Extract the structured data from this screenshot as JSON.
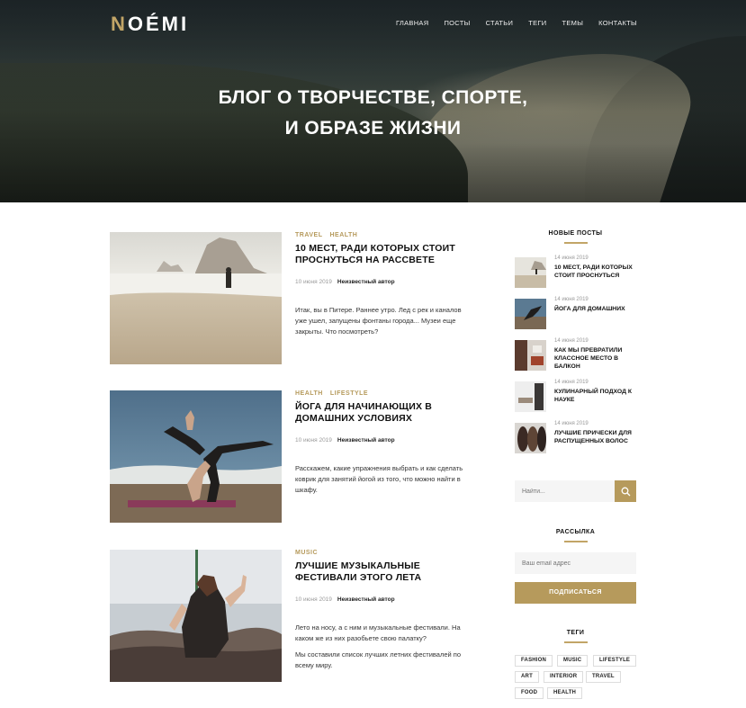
{
  "brand": {
    "logo_first": "N",
    "logo_rest": "OÉMI",
    "accent": "#c2a567"
  },
  "nav": [
    "ГЛАВНАЯ",
    "ПОСТЫ",
    "СТАТЬИ",
    "ТЕГИ",
    "ТЕМЫ",
    "КОНТАКТЫ"
  ],
  "hero": {
    "line1": "БЛОГ О ТВОРЧЕСТВЕ, СПОРТЕ,",
    "line2": "И ОБРАЗЕ ЖИЗНИ"
  },
  "posts": [
    {
      "cats": [
        "TRAVEL",
        "HEALTH"
      ],
      "title": "10 МЕСТ, РАДИ КОТОРЫХ СТОИТ ПРОСНУТЬСЯ НА РАССВЕТЕ",
      "date": "10 июня 2019",
      "author": "Неизвестный автор",
      "excerpt": "Итак, вы в Питере. Раннее утро. Лед с рек и каналов уже ушел, запущены фонтаны города... Музеи еще закрыты. Что посмотреть?"
    },
    {
      "cats": [
        "HEALTH",
        "LIFESTYLE"
      ],
      "title": "ЙОГА ДЛЯ НАЧИНАЮЩИХ В ДОМАШНИХ УСЛОВИЯХ",
      "date": "10 июня 2019",
      "author": "Неизвестный автор",
      "excerpt": "Расскажем, какие упражнения выбрать и как сделать коврик для занятий йогой из того, что можно найти в шкафу."
    },
    {
      "cats": [
        "MUSIC"
      ],
      "title": "ЛУЧШИЕ МУЗЫКАЛЬНЫЕ ФЕСТИВАЛИ ЭТОГО ЛЕТА",
      "date": "10 июня 2019",
      "author": "Неизвестный автор",
      "excerpt": "Лето на носу, а с ним и музыкальные фестивали. На каком же из них разобьете свою палатку?",
      "excerpt2": "Мы составили список лучших летних фестивалей по всему миру."
    }
  ],
  "sidebar": {
    "recent_heading": "НОВЫЕ ПОСТЫ",
    "recent": [
      {
        "date": "14 июня 2019",
        "title": "10 МЕСТ, РАДИ КОТОРЫХ СТОИТ ПРОСНУТЬСЯ"
      },
      {
        "date": "14 июня 2019",
        "title": "ЙОГА ДЛЯ ДОМАШНИХ"
      },
      {
        "date": "14 июня 2019",
        "title": "КАК МЫ ПРЕВРАТИЛИ КЛАССНОЕ МЕСТО В БАЛКОН"
      },
      {
        "date": "14 июня 2019",
        "title": "КУЛИНАРНЫЙ ПОДХОД К НАУКЕ"
      },
      {
        "date": "14 июня 2019",
        "title": "ЛУЧШИЕ ПРИЧЕСКИ ДЛЯ РАСПУЩЕННЫХ ВОЛОС"
      }
    ],
    "search_placeholder": "Найти...",
    "newsletter_heading": "РАССЫЛКА",
    "email_placeholder": "Ваш email адрес",
    "subscribe_label": "ПОДПИСАТЬСЯ",
    "tags_heading": "ТЕГИ",
    "tags": [
      "FASHION",
      "MUSIC",
      "LIFESTYLE",
      "ART",
      "INTERIOR",
      "TRAVEL",
      "FOOD",
      "HEALTH"
    ]
  }
}
